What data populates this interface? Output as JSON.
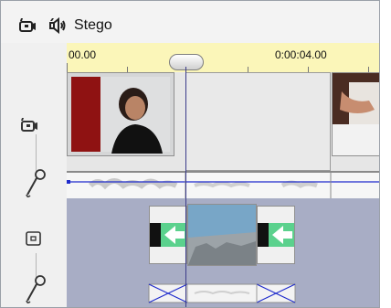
{
  "header": {
    "title": "Stego",
    "icons": [
      "video-track-icon",
      "audio-track-icon"
    ]
  },
  "ruler": {
    "labels": [
      "00.00",
      "0:00:04.00"
    ]
  },
  "tracks": {
    "left_icons": [
      "video-track-icon",
      "audio-level-icon",
      "overlay-track-icon",
      "audio-level-icon"
    ]
  },
  "colors": {
    "ruler_bg": "#fbf6b9",
    "overlay_bg": "#a8adc5",
    "transition_green": "#49c07a",
    "playhead": "#3b3b8a"
  }
}
